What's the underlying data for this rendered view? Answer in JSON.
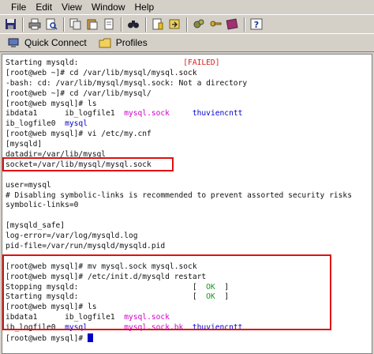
{
  "menu": {
    "items": [
      "File",
      "Edit",
      "View",
      "Window",
      "Help"
    ]
  },
  "toolbar": {
    "icons": [
      "save-icon",
      "print-icon",
      "print-preview-icon",
      "copy-icon",
      "paste-icon",
      "cut-icon",
      "find-icon",
      "new-file-icon",
      "file-transfer-icon",
      "settings-icon",
      "keys-icon",
      "profile-icon",
      "help-icon"
    ]
  },
  "quickbar": {
    "quick_connect_label": "Quick Connect",
    "profiles_label": "Profiles"
  },
  "terminal": {
    "l01": "Starting mysqld:",
    "l01_status": "[FAILED]",
    "l02": "[root@web ~]# cd /var/lib/mysql/mysql.sock",
    "l03": "-bash: cd: /var/lib/mysql/mysql.sock: Not a directory",
    "l04": "[root@web ~]# cd /var/lib/mysql/",
    "l05": "[root@web mysql]# ls",
    "l06_a": "ibdata1",
    "l06_b": "ib_logfile1",
    "l06_c": "mysql.sock",
    "l06_d": "thuviencntt",
    "l07_a": "ib_logfile0",
    "l07_b": "mysql",
    "l08": "[root@web mysql]# vi /etc/my.cnf",
    "l09": "[mysqld]",
    "l10": "datadir=/var/lib/mysql",
    "l11": "socket=/var/lib/mysql/mysql.sock",
    "l12": "",
    "l13": "user=mysql",
    "l14": "# Disabling symbolic-links is recommended to prevent assorted security risks",
    "l15": "symbolic-links=0",
    "l16": "",
    "l17": "[mysqld_safe]",
    "l18": "log-error=/var/log/mysqld.log",
    "l19": "pid-file=/var/run/mysqld/mysqld.pid",
    "l20": "",
    "l21": "[root@web mysql]# mv mysql.sock mysql.sock",
    "l22": "[root@web mysql]# /etc/init.d/mysqld restart",
    "l23": "Stopping mysqld:",
    "l23_status_ok": "OK",
    "l24": "Starting mysqld:",
    "l24_status_ok": "OK",
    "l25": "[root@web mysql]# ls",
    "l26_a": "ibdata1",
    "l26_b": "ib_logfile1",
    "l26_c": "mysql.sock",
    "l27_a": "ib_logfile0",
    "l27_b": "mysql",
    "l27_c": "mysql.sock.bk",
    "l27_d": "thuviencntt",
    "l28": "[root@web mysql]# "
  },
  "colors": {
    "highlight_box": "#e01010",
    "ls_file": "#cc00cc",
    "ls_dir": "#0000cc",
    "failed": "#d42020",
    "ok": "#1a9a1a"
  }
}
